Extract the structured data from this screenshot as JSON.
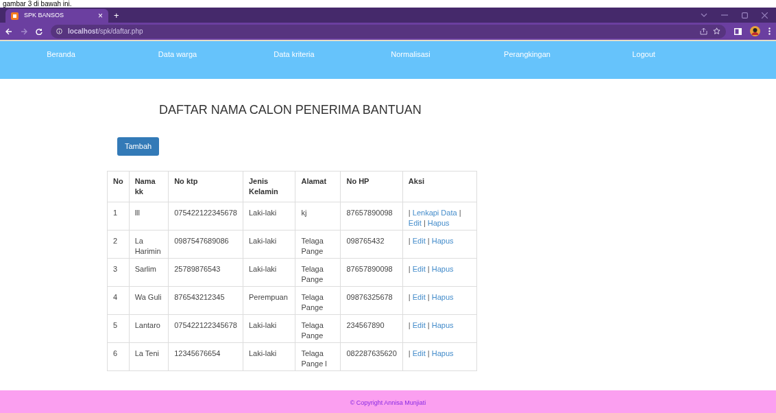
{
  "caption": "gambar 3 di bawah ini.",
  "browser": {
    "tab": {
      "title": "SPK BANSOS",
      "close": "×",
      "selected": true
    },
    "new_tab": "+",
    "url": "**localhost**/spk/daftar.php"
  },
  "nav": [
    {
      "label": "Beranda"
    },
    {
      "label": "Data warga"
    },
    {
      "label": "Data kriteria"
    },
    {
      "label": "Normalisasi"
    },
    {
      "label": "Perangkingan"
    },
    {
      "label": "Logout"
    }
  ],
  "heading": "DAFTAR NAMA CALON PENERIMA BANTUAN",
  "add_button": "Tambah",
  "table": {
    "columns": [
      "No",
      "Nama kk",
      "No ktp",
      "Jenis Kelamin",
      "Alamat",
      "No HP",
      "Aksi"
    ],
    "rows": [
      {
        "cells": [
          "1",
          "lll",
          "075422122345678",
          "Laki-laki",
          "kj",
          "87657890098"
        ],
        "actions": [
          {
            "kind": "sep",
            "text": "|"
          },
          {
            "kind": "link",
            "text": "Lenkapi Data"
          },
          {
            "kind": "sep",
            "text": "|"
          },
          {
            "kind": "link",
            "text": "Edit"
          },
          {
            "kind": "sep",
            "text": "|"
          },
          {
            "kind": "link",
            "text": "Hapus"
          }
        ]
      },
      {
        "cells": [
          "2",
          "La Harimin",
          "0987547689086",
          "Laki-laki",
          "Telaga Pange",
          "098765432"
        ],
        "actions": [
          {
            "kind": "sep",
            "text": "|"
          },
          {
            "kind": "link",
            "text": "Edit"
          },
          {
            "kind": "sep",
            "text": "|"
          },
          {
            "kind": "link",
            "text": "Hapus"
          }
        ]
      },
      {
        "cells": [
          "3",
          "Sarlim",
          "25789876543",
          "Laki-laki",
          "Telaga Pange",
          "87657890098"
        ],
        "actions": [
          {
            "kind": "sep",
            "text": "|"
          },
          {
            "kind": "link",
            "text": "Edit"
          },
          {
            "kind": "sep",
            "text": "|"
          },
          {
            "kind": "link",
            "text": "Hapus"
          }
        ]
      },
      {
        "cells": [
          "4",
          "Wa Guli",
          "876543212345",
          "Perempuan",
          "Telaga Pange",
          "09876325678"
        ],
        "actions": [
          {
            "kind": "sep",
            "text": "|"
          },
          {
            "kind": "link",
            "text": "Edit"
          },
          {
            "kind": "sep",
            "text": "|"
          },
          {
            "kind": "link",
            "text": "Hapus"
          }
        ]
      },
      {
        "cells": [
          "5",
          "Lantaro",
          "075422122345678",
          "Laki-laki",
          "Telaga Pange",
          "234567890"
        ],
        "actions": [
          {
            "kind": "sep",
            "text": "|"
          },
          {
            "kind": "link",
            "text": "Edit"
          },
          {
            "kind": "sep",
            "text": "|"
          },
          {
            "kind": "link",
            "text": "Hapus"
          }
        ]
      },
      {
        "cells": [
          "6",
          "La Teni",
          "12345676654",
          "Laki-laki",
          "Telaga Pange l",
          "082287635620"
        ],
        "actions": [
          {
            "kind": "sep",
            "text": "|"
          },
          {
            "kind": "link",
            "text": "Edit"
          },
          {
            "kind": "sep",
            "text": "|"
          },
          {
            "kind": "link",
            "text": "Hapus"
          }
        ]
      }
    ]
  },
  "footer": "© Copyright Annisa Munjiati"
}
